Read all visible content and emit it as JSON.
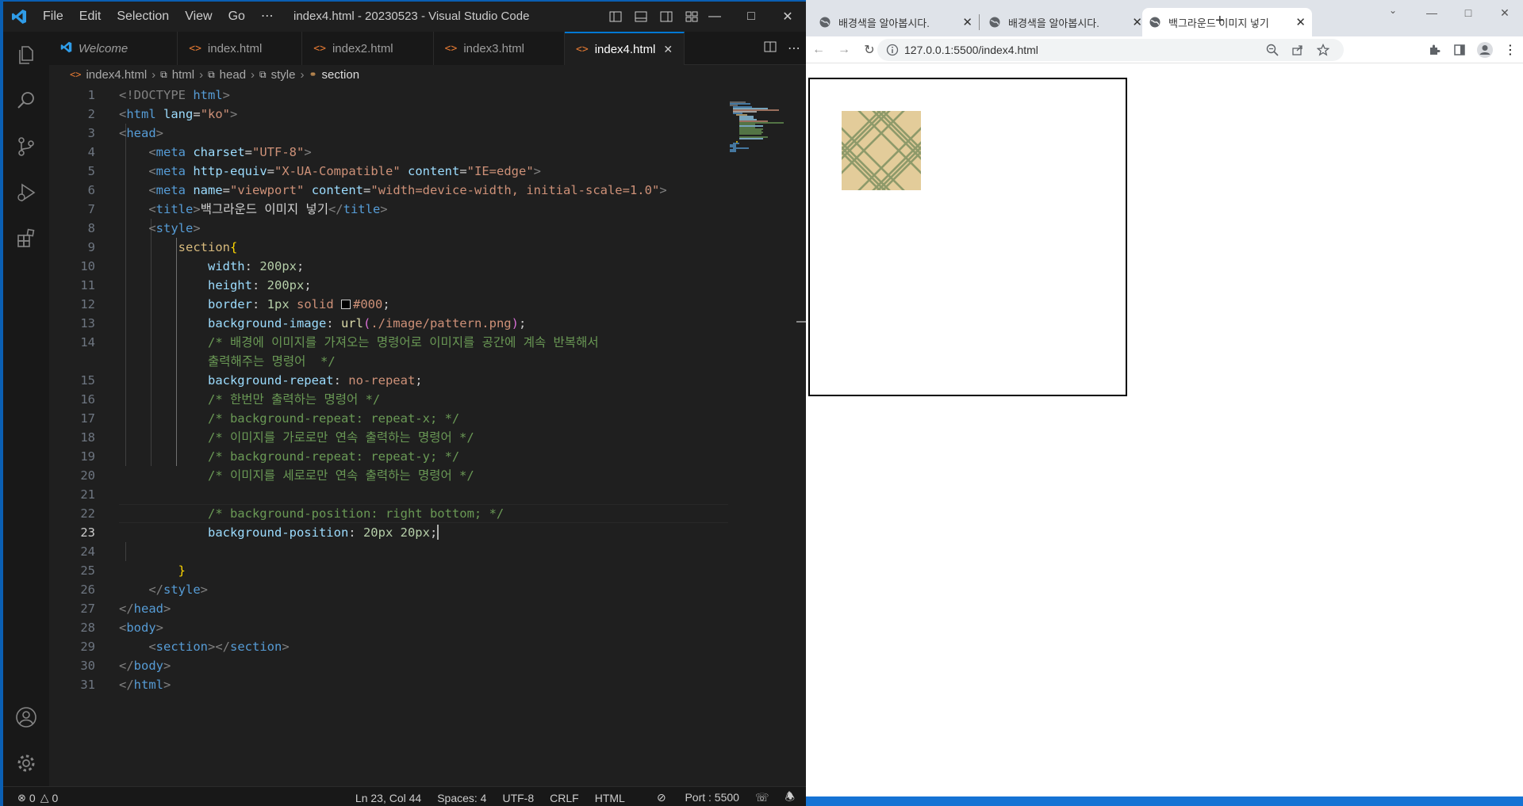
{
  "vscode": {
    "menu": [
      "File",
      "Edit",
      "Selection",
      "View",
      "Go",
      "⋯"
    ],
    "window_title": "index4.html - 20230523 - Visual Studio Code",
    "tabs": [
      {
        "label": "Welcome",
        "icon": "vscode-logo-icon",
        "active": false
      },
      {
        "label": "index.html",
        "icon": "html-file-icon",
        "active": false
      },
      {
        "label": "index2.html",
        "icon": "html-file-icon",
        "active": false
      },
      {
        "label": "index3.html",
        "icon": "html-file-icon",
        "active": false
      },
      {
        "label": "index4.html",
        "icon": "html-file-icon",
        "active": true
      }
    ],
    "breadcrumb": [
      "index4.html",
      "html",
      "head",
      "style",
      "section"
    ],
    "line_numbers": [
      "1",
      "2",
      "3",
      "4",
      "5",
      "6",
      "7",
      "8",
      "9",
      "10",
      "11",
      "12",
      "13",
      "14",
      "",
      "15",
      "16",
      "17",
      "18",
      "19",
      "20",
      "21",
      "22",
      "23",
      "24",
      "25",
      "26",
      "27",
      "28",
      "29",
      "30",
      "31"
    ],
    "current_line": "23",
    "code": {
      "l1_doctype": "<!DOCTYPE",
      "l1_html": "html",
      "l2_tag": "html",
      "l2_attr": "lang",
      "l2_val": "\"ko\"",
      "l3_tag": "head",
      "l4_tag": "meta",
      "l4_attr": "charset",
      "l4_val": "\"UTF-8\"",
      "l5_tag": "meta",
      "l5_attr1": "http-equiv",
      "l5_val1": "\"X-UA-Compatible\"",
      "l5_attr2": "content",
      "l5_val2": "\"IE=edge\"",
      "l6_tag": "meta",
      "l6_attr1": "name",
      "l6_val1": "\"viewport\"",
      "l6_attr2": "content",
      "l6_val2": "\"width=device-width, initial-scale=1.0\"",
      "l7_tag": "title",
      "l7_text": "백그라운드 이미지 넣기",
      "l8_tag": "style",
      "l9_sel": "section",
      "l10_prop": "width",
      "l10_val": "200px",
      "l11_prop": "height",
      "l11_val": "200px",
      "l12_prop": "border",
      "l12_val1": "1px",
      "l12_val2": "solid",
      "l12_val3": "#000",
      "l13_prop": "background-image",
      "l13_fn": "url",
      "l13_arg": "./image/pattern.png",
      "l14_com_a": "/* 배경에 이미지를 가져오는 명령어로 이미지를 공간에 계속 반복해서",
      "l14_com_b": "출력해주는 명령어  */",
      "l15_prop": "background-repeat",
      "l15_val": "no-repeat",
      "l16_com": "/* 한번만 출력하는 명령어 */",
      "l17_com": "/* background-repeat: repeat-x; */",
      "l18_com": "/* 이미지를 가로로만 연속 출력하는 명령어 */",
      "l19_com": "/* background-repeat: repeat-y; */",
      "l20_com": "/* 이미지를 세로로만 연속 출력하는 명령어 */",
      "l22_com": "/* background-position: right bottom; */",
      "l23_prop": "background-position",
      "l23_val1": "20px",
      "l23_val2": "20px",
      "l26_tag": "style",
      "l27_tag": "head",
      "l28_tag": "body",
      "l29_tag1": "section",
      "l29_tag2": "section",
      "l30_tag": "body",
      "l31_tag": "html"
    },
    "status": {
      "errors": "0",
      "warnings": "0",
      "position": "Ln 23, Col 44",
      "spaces": "Spaces: 4",
      "encoding": "UTF-8",
      "eol": "CRLF",
      "language": "HTML",
      "port": "Port : 5500"
    }
  },
  "chrome": {
    "tabs": [
      {
        "title": "배경색을 알아봅시다.",
        "active": false
      },
      {
        "title": "배경색을 알아봅시다.",
        "active": false
      },
      {
        "title": "백그라운드 이미지 넣기",
        "active": true
      }
    ],
    "new_tab": "+",
    "url": "127.0.0.1:5500/index4.html"
  },
  "colors": {
    "vscode_bg": "#1f1f1f",
    "accent": "#0078d4",
    "pattern_bg": "#e3cc9a",
    "pattern_line": "#8e9a6a"
  }
}
